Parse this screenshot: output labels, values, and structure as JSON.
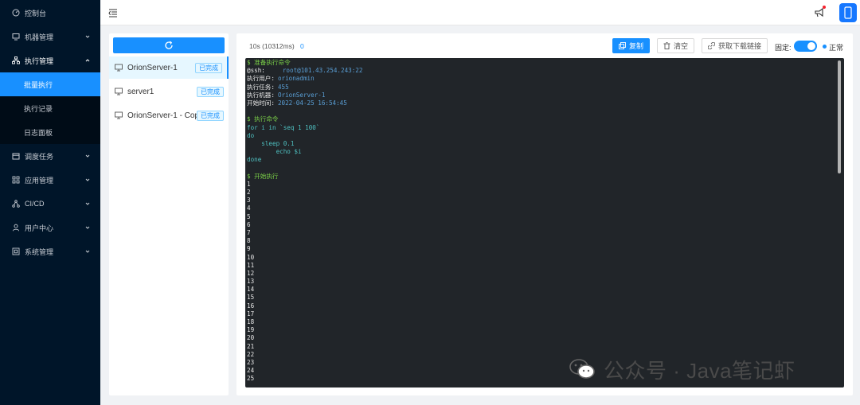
{
  "sidebar": {
    "items": [
      {
        "label": "控制台",
        "icon": "dashboard-icon"
      },
      {
        "label": "机器管理",
        "icon": "monitor-icon"
      },
      {
        "label": "执行管理",
        "icon": "cluster-icon"
      },
      {
        "label": "调度任务",
        "icon": "schedule-icon"
      },
      {
        "label": "应用管理",
        "icon": "appstore-icon"
      },
      {
        "label": "CI/CD",
        "icon": "deploy-icon"
      },
      {
        "label": "用户中心",
        "icon": "user-icon"
      },
      {
        "label": "系统管理",
        "icon": "setting-icon"
      }
    ],
    "exec_sub": [
      "批量执行",
      "执行记录",
      "日志面板"
    ]
  },
  "hosts": [
    {
      "name": "OrionServer-1",
      "status": "已完成"
    },
    {
      "name": "server1",
      "status": "已完成"
    },
    {
      "name": "OrionServer-1 - Copy",
      "status": "已完成"
    }
  ],
  "exec": {
    "time": "10s (10312ms)",
    "exit_code": "0",
    "copy_label": "复制",
    "clear_label": "清空",
    "download_label": "获取下载链接",
    "fixed_label": "固定:",
    "status_label": "正常"
  },
  "terminal": {
    "prep_header": "$ 准备执行命令",
    "ssh_key": "@ssh:",
    "ssh_val": "root@101.43.254.243:22",
    "user_key": "执行用户:",
    "user_val": "orionadmin",
    "task_key": "执行任务:",
    "task_val": "455",
    "machine_key": "执行机器:",
    "machine_val": "OrionServer-1",
    "start_key": "开始时间:",
    "start_val": "2022-04-25 16:54:45",
    "cmd_header": "$ 执行命令",
    "cmd_lines": [
      "for i in `seq 1 100`",
      "do",
      "    sleep 0.1",
      "        echo $i",
      "done"
    ],
    "run_header": "$ 开始执行",
    "output": [
      "1",
      "2",
      "3",
      "4",
      "5",
      "6",
      "7",
      "8",
      "9",
      "10",
      "11",
      "12",
      "13",
      "14",
      "15",
      "16",
      "17",
      "18",
      "19",
      "20",
      "21",
      "22",
      "23",
      "24",
      "25"
    ]
  },
  "watermark": {
    "text": "公众号 · Java笔记虾"
  },
  "colors": {
    "primary": "#1890ff",
    "sidebar_bg": "#001529",
    "terminal_bg": "#212529",
    "term_green": "#7bd148",
    "term_blue": "#5a9fd6"
  }
}
